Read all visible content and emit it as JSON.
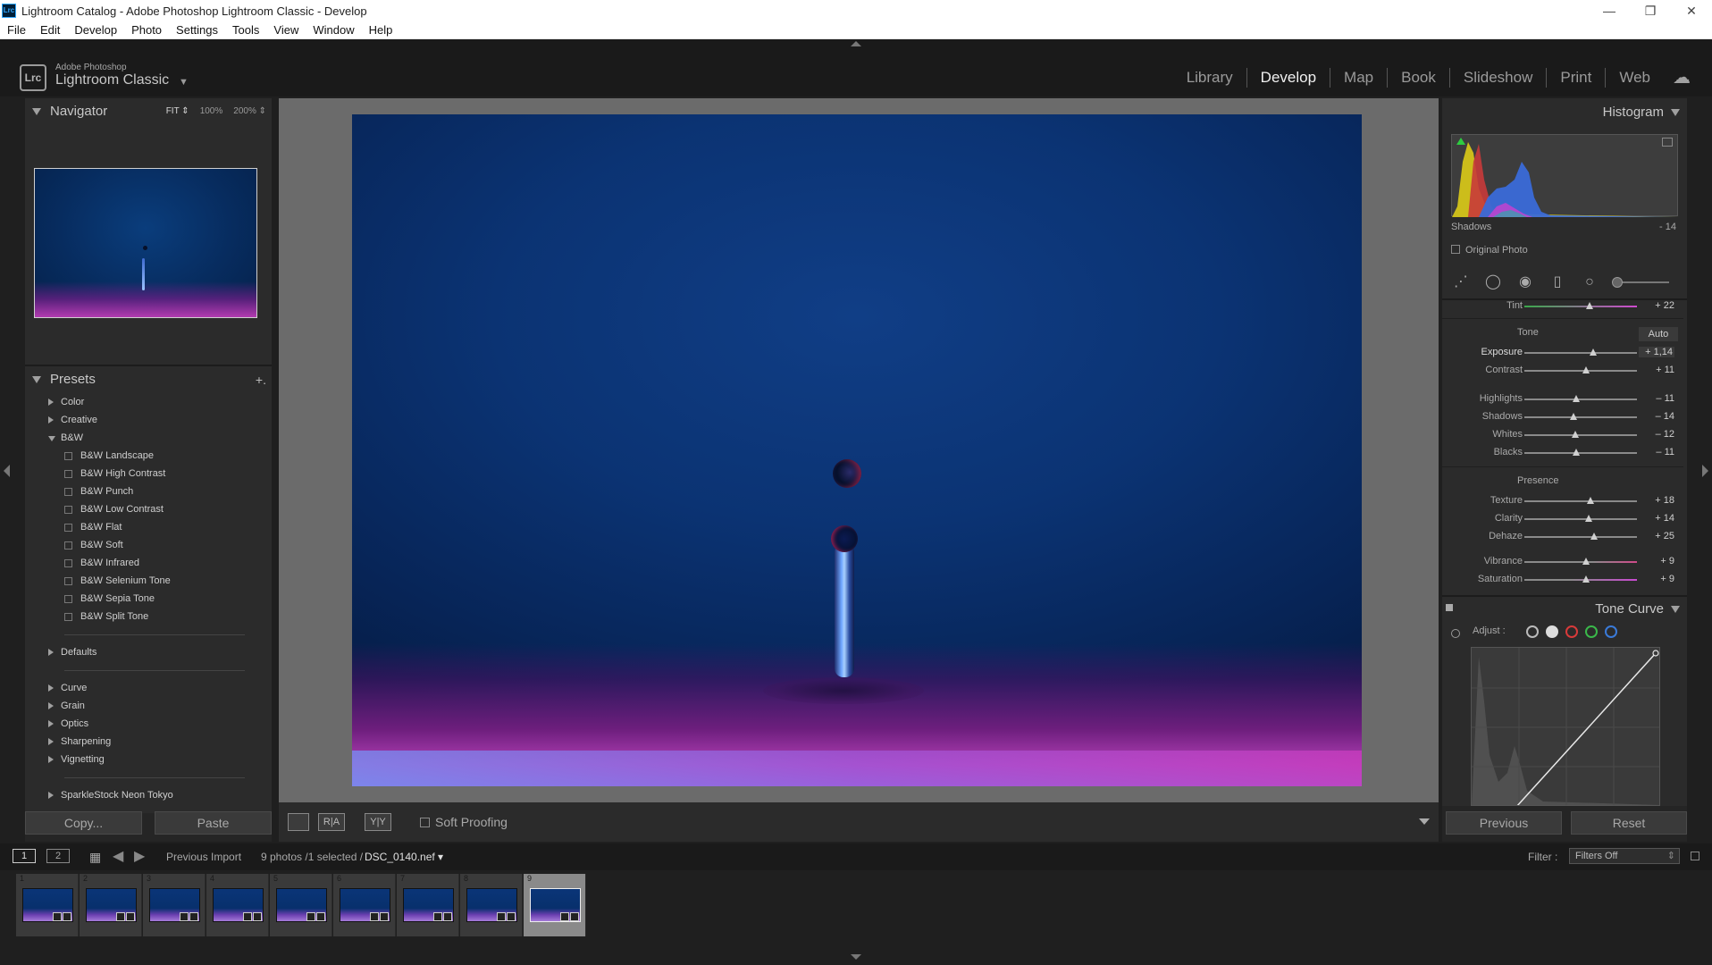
{
  "window": {
    "title": "Lightroom Catalog - Adobe Photoshop Lightroom Classic - Develop",
    "app_icon": "Lrc",
    "controls": [
      "—",
      "❐",
      "✕"
    ]
  },
  "menu": [
    "File",
    "Edit",
    "Develop",
    "Photo",
    "Settings",
    "Tools",
    "View",
    "Window",
    "Help"
  ],
  "identity": {
    "badge": "Lrc",
    "brand_small": "Adobe Photoshop",
    "brand_large": "Lightroom Classic",
    "caret": "▼"
  },
  "modules": [
    {
      "label": "Library",
      "active": false
    },
    {
      "label": "Develop",
      "active": true
    },
    {
      "label": "Map",
      "active": false
    },
    {
      "label": "Book",
      "active": false
    },
    {
      "label": "Slideshow",
      "active": false
    },
    {
      "label": "Print",
      "active": false
    },
    {
      "label": "Web",
      "active": false
    }
  ],
  "cloud_icon": "☁",
  "navigator": {
    "title": "Navigator",
    "zoom": [
      "FIT ⇕",
      "100%",
      "200% ⇕"
    ]
  },
  "presets": {
    "title": "Presets",
    "add": "+.",
    "groups_before": [
      {
        "label": "Color"
      },
      {
        "label": "Creative"
      }
    ],
    "open_group": {
      "label": "B&W"
    },
    "items": [
      "B&W Landscape",
      "B&W High Contrast",
      "B&W Punch",
      "B&W Low Contrast",
      "B&W Flat",
      "B&W Soft",
      "B&W Infrared",
      "B&W Selenium Tone",
      "B&W Sepia Tone",
      "B&W Split Tone"
    ],
    "defaults": "Defaults",
    "groups_after": [
      "Curve",
      "Grain",
      "Optics",
      "Sharpening",
      "Vignetting"
    ],
    "last_group": "SparkleStock Neon Tokyo"
  },
  "left_buttons": {
    "copy": "Copy...",
    "paste": "Paste"
  },
  "toolbar": {
    "loupe": "",
    "before_after_ra": "R|A",
    "before_after_yy": "Y|Y",
    "soft_proofing": "Soft Proofing"
  },
  "histogram": {
    "title": "Histogram",
    "label": "Shadows",
    "value": "- 14",
    "original_photo": "Original Photo"
  },
  "basic": {
    "tint": {
      "label": "Tint",
      "value": "+ 22",
      "pos": 0.58
    },
    "tone_title": "Tone",
    "auto": "Auto",
    "sliders_tone": [
      {
        "label": "Exposure",
        "value": "+ 1,14",
        "pos": 0.61,
        "highlight": true
      },
      {
        "label": "Contrast",
        "value": "+ 11",
        "pos": 0.55,
        "highlight": false
      }
    ],
    "sliders_tone2": [
      {
        "label": "Highlights",
        "value": "– 11",
        "pos": 0.46
      },
      {
        "label": "Shadows",
        "value": "– 14",
        "pos": 0.44
      },
      {
        "label": "Whites",
        "value": "– 12",
        "pos": 0.45
      },
      {
        "label": "Blacks",
        "value": "– 11",
        "pos": 0.46
      }
    ],
    "presence_title": "Presence",
    "sliders_presence": [
      {
        "label": "Texture",
        "value": "+ 18",
        "pos": 0.59
      },
      {
        "label": "Clarity",
        "value": "+ 14",
        "pos": 0.57
      },
      {
        "label": "Dehaze",
        "value": "+ 25",
        "pos": 0.62
      }
    ],
    "sliders_color": [
      {
        "label": "Vibrance",
        "value": "+ 9",
        "pos": 0.545
      },
      {
        "label": "Saturation",
        "value": "+ 9",
        "pos": 0.545
      }
    ]
  },
  "tone_curve": {
    "title": "Tone Curve",
    "adjust": "Adjust :"
  },
  "right_buttons": {
    "previous": "Previous",
    "reset": "Reset"
  },
  "filmbar": {
    "screen1": "1",
    "screen2": "2",
    "source": "Previous Import",
    "count": "9 photos /1 selected /",
    "file": "DSC_0140.nef ▾",
    "filter_label": "Filter :",
    "filter_value": "Filters Off"
  },
  "filmstrip": {
    "thumbs": [
      "1",
      "2",
      "3",
      "4",
      "5",
      "6",
      "7",
      "8",
      "9"
    ],
    "selected": 8
  }
}
